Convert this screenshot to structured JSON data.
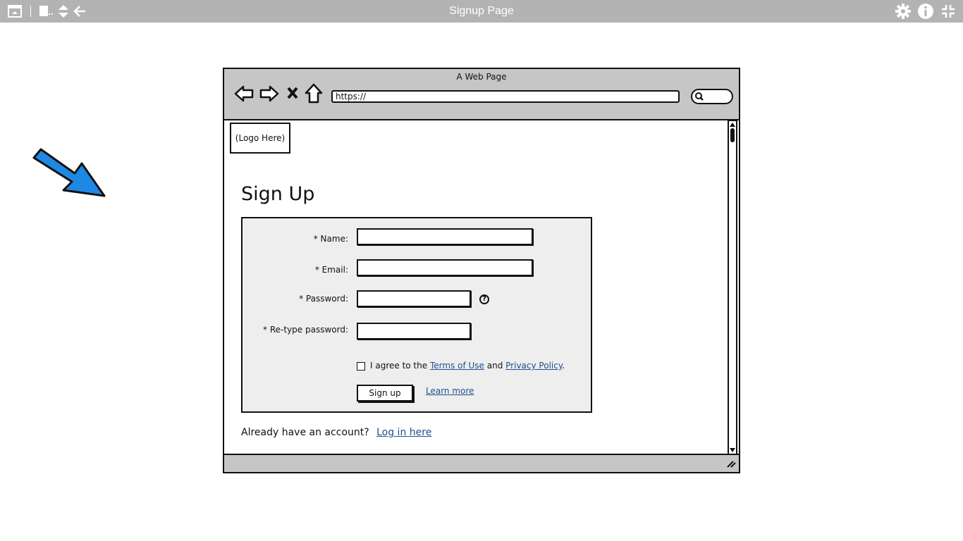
{
  "app": {
    "title": "Signup Page"
  },
  "toolbar": {
    "icons": [
      "window-icon",
      "pages-icon",
      "sort-icon",
      "back-arrow-icon",
      "gear-icon",
      "info-icon",
      "collapse-icon"
    ]
  },
  "browser": {
    "page_title": "A Web Page",
    "url": "https://"
  },
  "page": {
    "logo": "(Logo Here)",
    "heading": "Sign Up",
    "form": {
      "name_label": "* Name:",
      "email_label": "* Email:",
      "password_label": "* Password:",
      "retype_label": "* Re-type password:",
      "help_glyph": "?",
      "agree_prefix": "I agree to the",
      "terms_link": "Terms of Use",
      "agree_and": "and",
      "privacy_link": "Privacy Policy",
      "agree_suffix": ".",
      "signup_button": "Sign up",
      "learn_more": "Learn more"
    },
    "already_text": "Already have an account?",
    "login_link": "Log in here"
  },
  "colors": {
    "toolbar_bg": "#b3b3b3",
    "chrome_bg": "#c6c6c6",
    "panel_bg": "#eeeeee",
    "link": "#1f4f8f",
    "arrow": "#1e88e5"
  }
}
